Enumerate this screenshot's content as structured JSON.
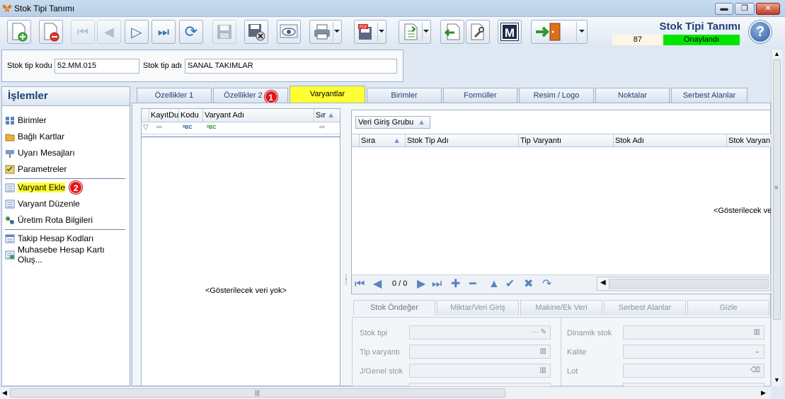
{
  "window": {
    "title": "Stok Tipi Tanımı"
  },
  "header": {
    "title": "Stok Tipi Tanımı",
    "number": "87",
    "status": "Onaylandı",
    "status_color": "#00e600"
  },
  "toolbar": {
    "buttons": [
      "new-record",
      "delete-record",
      "first-record",
      "previous-record",
      "next-record",
      "last-record",
      "refresh",
      "save",
      "save-close",
      "preview",
      "print",
      "pdf-export",
      "excel-export",
      "import",
      "tools",
      "m-module",
      "exit"
    ]
  },
  "stock_type": {
    "code_label": "Stok tip kodu",
    "code_value": "52.MM.015",
    "name_label": "Stok tip adı",
    "name_value": "SANAL TAKIMLAR"
  },
  "operations": {
    "title": "İşlemler",
    "items": [
      {
        "label": "Birimler"
      },
      {
        "label": "Bağlı Kartlar"
      },
      {
        "label": "Uyarı Mesajları"
      },
      {
        "label": "Parametreler"
      },
      {
        "label": "Varyant Ekle",
        "badge": "2"
      },
      {
        "label": "Varyant Düzenle"
      },
      {
        "label": "Üretim Rota Bilgileri"
      },
      {
        "label": "Takip Hesap Kodları"
      },
      {
        "label": "Muhasebe Hesap Kartı Oluş..."
      }
    ]
  },
  "tabs": [
    {
      "label": "Özellikler 1"
    },
    {
      "label": "Özellikler 2",
      "badge": "1"
    },
    {
      "label": "Varyantlar"
    },
    {
      "label": "Birimler"
    },
    {
      "label": "Formüller"
    },
    {
      "label": "Resim / Logo"
    },
    {
      "label": "Noktalar"
    },
    {
      "label": "Serbest Alanlar"
    }
  ],
  "variant_grid": {
    "columns": [
      "KayıtDu",
      "Kodu",
      "Varyant Adı",
      "Sır"
    ],
    "empty_text": "<Gösterilecek veri yok>"
  },
  "entry_grid": {
    "group_label": "Veri Giriş Grubu",
    "columns": [
      "Sıra",
      "Stok Tip Adı",
      "Tip Varyantı",
      "Stok Adı",
      "Stok Varyan"
    ],
    "empty_text": "<Gösterilecek ve",
    "pager": "0 / 0"
  },
  "bottom_tabs": [
    "Stok Öndeğer",
    "Miktar/Veri Giriş",
    "Makine/Ek Veri",
    "Serbest Alanlar",
    "Gizle"
  ],
  "form": {
    "left": [
      {
        "label": "Stok tipi"
      },
      {
        "label": "Tip varyantı"
      },
      {
        "label": "J/Genel stok"
      }
    ],
    "right": [
      {
        "label": "Dinamik stok"
      },
      {
        "label": "Kalite"
      },
      {
        "label": "Lot"
      }
    ]
  }
}
